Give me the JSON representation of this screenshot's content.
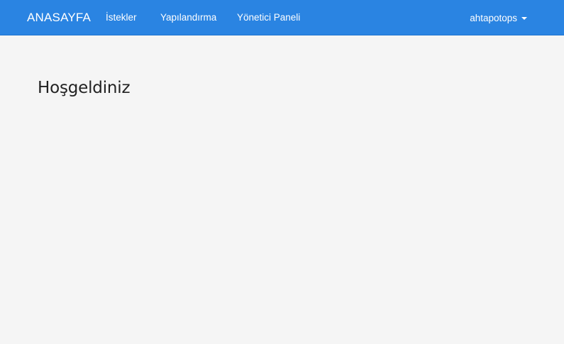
{
  "navbar": {
    "brand": "ANASAYFA",
    "links": [
      {
        "label": "İstekler"
      },
      {
        "label": "Yapılandırma"
      },
      {
        "label": "Yönetici Paneli"
      }
    ],
    "user": {
      "name": "ahtapotops",
      "icon": "caret-down-icon"
    },
    "colors": {
      "background": "#2a84e2",
      "text": "#ffffff"
    }
  },
  "main": {
    "title": "Hoşgeldiniz",
    "background": "#f5f5f5"
  }
}
